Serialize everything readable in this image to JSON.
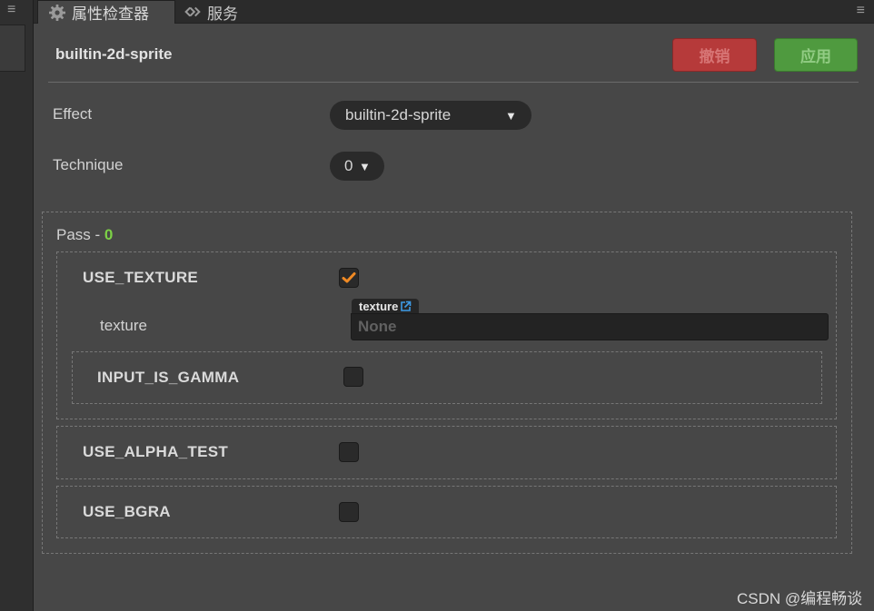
{
  "tabs": {
    "inspector": {
      "label": "属性检查器",
      "icon": "gear-icon"
    },
    "service": {
      "label": "服务",
      "icon": "service-link-icon"
    }
  },
  "header": {
    "title": "builtin-2d-sprite",
    "undo_label": "撤销",
    "apply_label": "应用"
  },
  "properties": {
    "effect": {
      "label": "Effect",
      "value": "builtin-2d-sprite"
    },
    "technique": {
      "label": "Technique",
      "value": "0"
    }
  },
  "pass": {
    "title": "Pass - ",
    "index": "0",
    "defines": [
      {
        "name": "USE_TEXTURE",
        "checked": true
      },
      {
        "name": "INPUT_IS_GAMMA",
        "checked": false
      },
      {
        "name": "USE_ALPHA_TEST",
        "checked": false
      },
      {
        "name": "USE_BGRA",
        "checked": false
      }
    ],
    "texture": {
      "label": "texture",
      "asset_type": "texture",
      "value": "None"
    }
  },
  "watermark": "CSDN @编程畅谈",
  "colors": {
    "background": "#474747",
    "undo": "#b63a3a",
    "apply": "#4f9a3f",
    "check_accent": "#f08a24",
    "pass_index": "#7cd146"
  }
}
